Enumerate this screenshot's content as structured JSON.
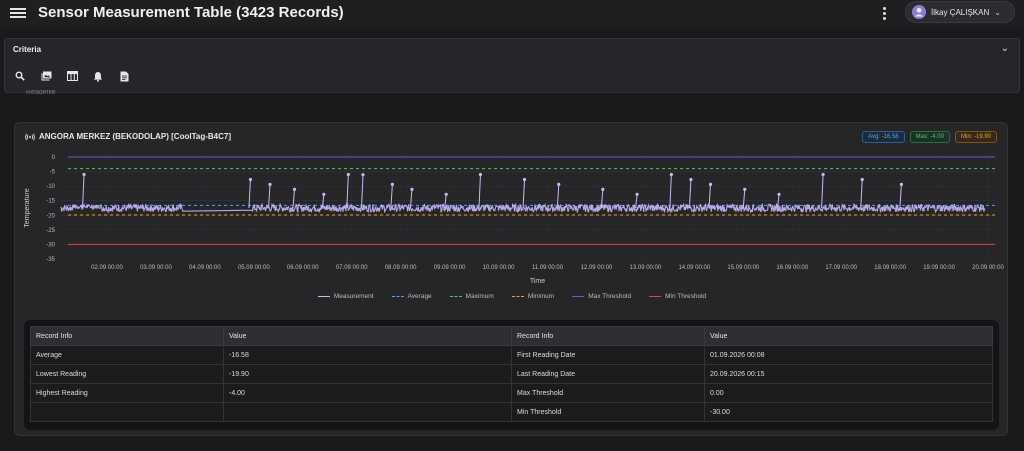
{
  "app": {
    "title": "Sensor Measurement Table (3423 Records)",
    "user_name": "İlkay ÇALIŞKAN"
  },
  "criteria": {
    "title": "Criteria",
    "toolbar_icons": [
      "search-icon",
      "gallery-icon",
      "table-icon",
      "bell-icon",
      "document-icon"
    ],
    "partial_text": "Readefile"
  },
  "device": {
    "icon": "sensor-signal-icon",
    "title": "ANGORA MERKEZ (BEKODOLAP) [CoolTag-B4C7]"
  },
  "badges": {
    "avg": "Avg: -16.58",
    "max": "Max: -4.00",
    "min": "Min: -19.90"
  },
  "colors": {
    "measurement": "#c9b8f5",
    "average": "#4da3ff",
    "maximum": "#48c774",
    "minimum": "#f0a030",
    "max_threshold": "#6a5acd",
    "min_threshold": "#e0443c",
    "background": "#1a1a1c",
    "card": "#262629"
  },
  "chart_data": {
    "type": "line",
    "ylabel": "Temperature",
    "xlabel": "Time",
    "ylim": [
      -35,
      0
    ],
    "yticks": [
      "0",
      "-5",
      "-10",
      "-15",
      "-20",
      "-25",
      "-30",
      "-35"
    ],
    "xticks": [
      "02.09 00:00",
      "03.09 00:00",
      "04.09 00:00",
      "05.09 00:00",
      "06.09 00:00",
      "07.09 00:00",
      "08.09 00:00",
      "09.09 00:00",
      "10.09 00:00",
      "11.09 00:00",
      "12.09 00:00",
      "13.09 00:00",
      "14.09 00:00",
      "15.09 00:00",
      "16.09 00:00",
      "17.09 00:00",
      "18.09 00:00",
      "19.09 00:00",
      "20.09 00:00"
    ],
    "grid": true,
    "legend_position": "bottom",
    "series": [
      {
        "name": "Measurement",
        "style": "solid-with-markers",
        "baseline": -17.5,
        "spike_days": [
          1.5,
          4.9,
          5.3,
          5.8,
          6.4,
          6.9,
          7.2,
          7.8,
          8.2,
          8.9,
          9.6,
          10.5,
          11.2,
          12.1,
          12.8,
          13.5,
          13.9,
          14.3,
          15.0,
          15.7,
          16.6,
          17.4,
          18.2
        ]
      },
      {
        "name": "Average",
        "style": "dashed",
        "value": -16.58
      },
      {
        "name": "Maximum",
        "style": "dashed",
        "value": -4.0
      },
      {
        "name": "Minimum",
        "style": "dashed",
        "value": -19.9
      },
      {
        "name": "Max Threshold",
        "style": "solid",
        "value": 0.0
      },
      {
        "name": "Min Threshold",
        "style": "solid",
        "value": -30.0
      }
    ]
  },
  "legend": [
    "Measurement",
    "Average",
    "Maximum",
    "Minimum",
    "Max Threshold",
    "Min Threshold"
  ],
  "table": {
    "headers": [
      "Record Info",
      "Value",
      "Record Info",
      "Value"
    ],
    "rows": [
      [
        "Average",
        "-16.58",
        "First Reading Date",
        "01.09.2026 00:08"
      ],
      [
        "Lowest Reading",
        "-19.90",
        "Last Reading Date",
        "20.09.2026 00:15"
      ],
      [
        "Highest Reading",
        "-4.00",
        "Max Threshold",
        "0.00"
      ],
      [
        "",
        "",
        "Min Threshold",
        "-30.00"
      ]
    ]
  }
}
